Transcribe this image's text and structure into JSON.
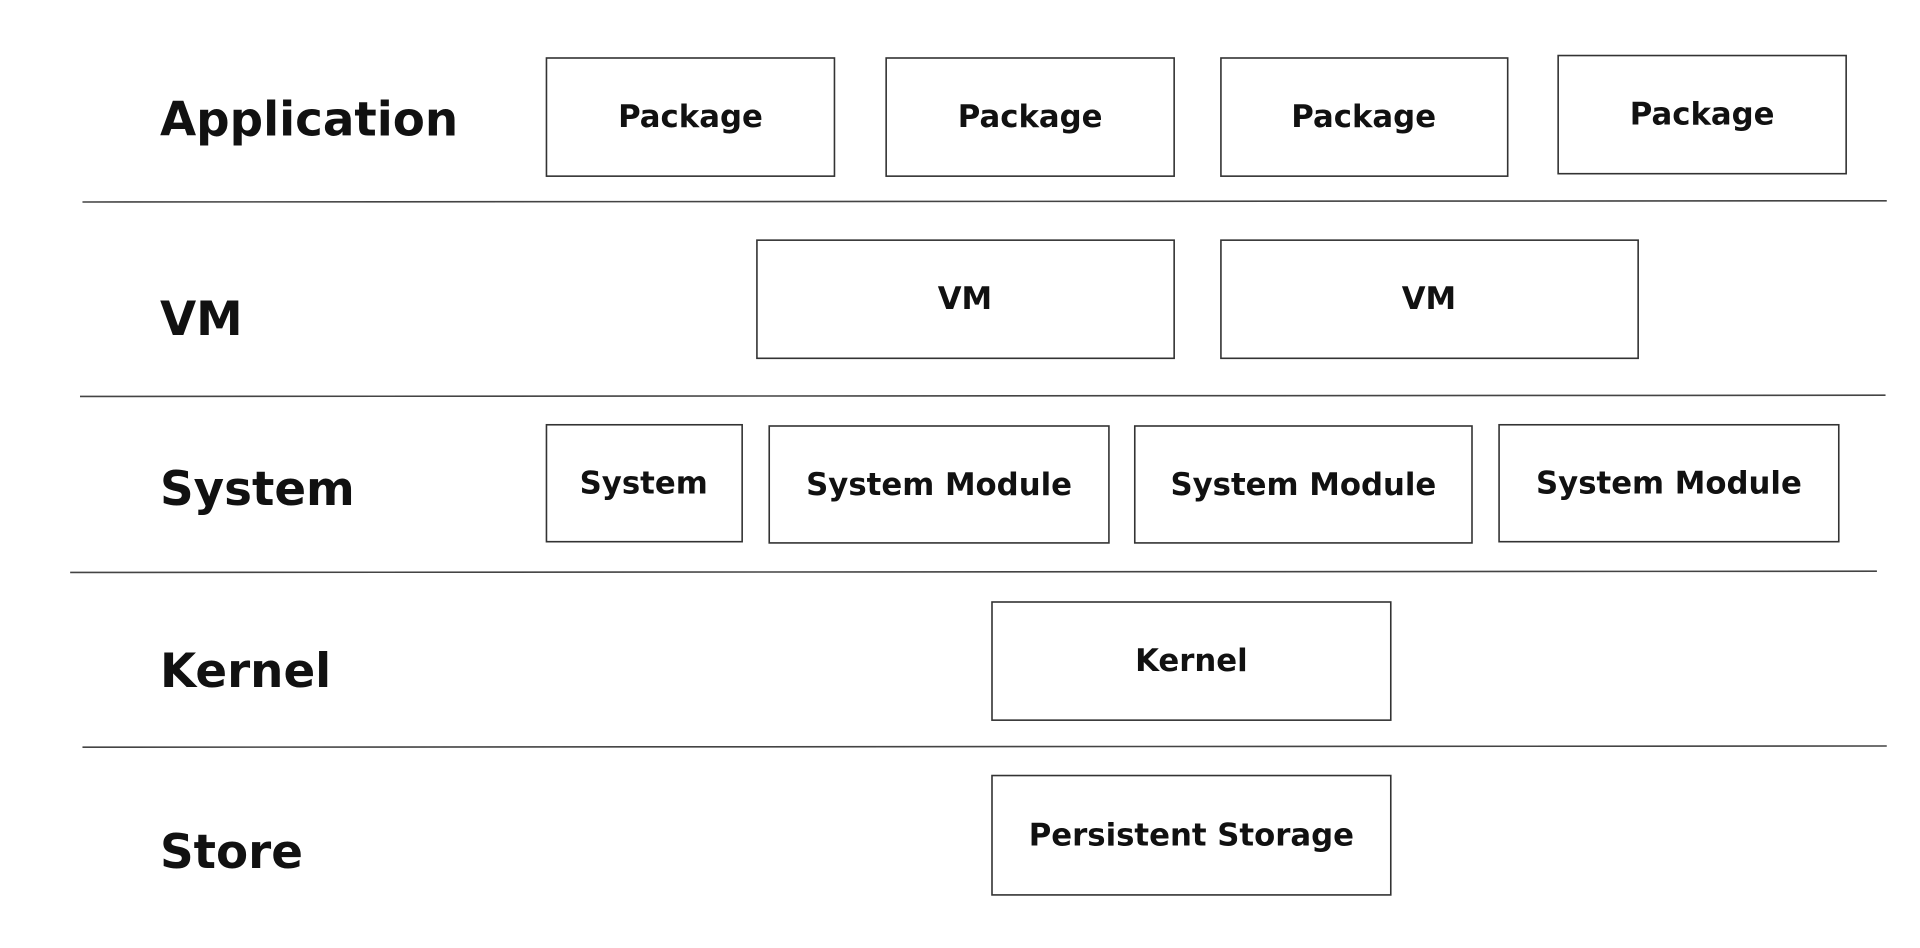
{
  "layers": [
    {
      "label": "Application",
      "boxes": [
        "Package",
        "Package",
        "Package",
        "Package"
      ]
    },
    {
      "label": "VM",
      "boxes": [
        "VM",
        "VM"
      ]
    },
    {
      "label": "System",
      "boxes": [
        "System",
        "System Module",
        "System Module",
        "System Module"
      ]
    },
    {
      "label": "Kernel",
      "boxes": [
        "Kernel"
      ]
    },
    {
      "label": "Store",
      "boxes": [
        "Persistent Storage"
      ]
    }
  ]
}
